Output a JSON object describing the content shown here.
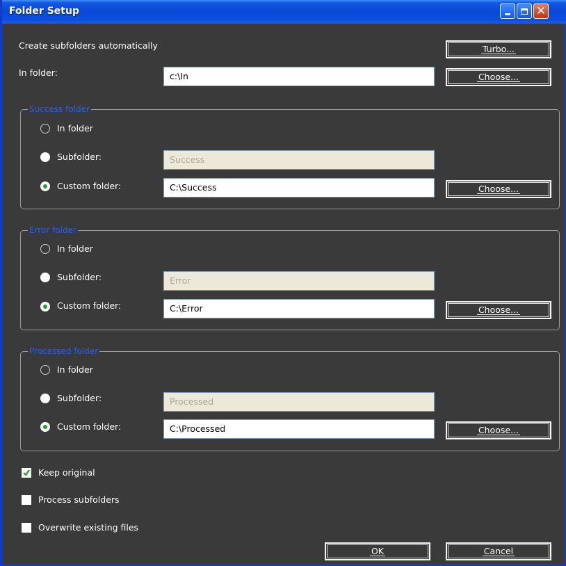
{
  "window": {
    "title": "Folder Setup"
  },
  "top": {
    "create_subfolders_label": "Create subfolders automatically",
    "turbo_label": "Turbo...",
    "in_folder_label": "In folder:",
    "in_folder_value": "c:\\In",
    "choose_label": "Choose..."
  },
  "groups": [
    {
      "legend": "Success folder",
      "in_folder_label": "In folder",
      "subfolder_label": "Subfolder:",
      "subfolder_value": "Success",
      "custom_label": "Custom folder:",
      "custom_value": "C:\\Success",
      "choose_label": "Choose...",
      "selected": "custom"
    },
    {
      "legend": "Error folder",
      "in_folder_label": "In folder",
      "subfolder_label": "Subfolder:",
      "subfolder_value": "Error",
      "custom_label": "Custom folder:",
      "custom_value": "C:\\Error",
      "choose_label": "Choose...",
      "selected": "custom"
    },
    {
      "legend": "Processed folder",
      "in_folder_label": "In folder",
      "subfolder_label": "Subfolder:",
      "subfolder_value": "Processed",
      "custom_label": "Custom folder:",
      "custom_value": "C:\\Processed",
      "choose_label": "Choose...",
      "selected": "custom"
    }
  ],
  "options": {
    "keep_original_label": "Keep original",
    "keep_original_checked": true,
    "process_subfolders_label": "Process subfolders",
    "process_subfolders_checked": false,
    "overwrite_label": "Overwrite existing files",
    "overwrite_checked": false
  },
  "buttons": {
    "ok_label": "OK",
    "cancel_label": "Cancel"
  },
  "colors": {
    "titlebar": "#0a47d6",
    "background": "#3a3a3a",
    "legend": "#2b5fe8",
    "radio_dot": "#21a121",
    "check_tick": "#21a121"
  }
}
